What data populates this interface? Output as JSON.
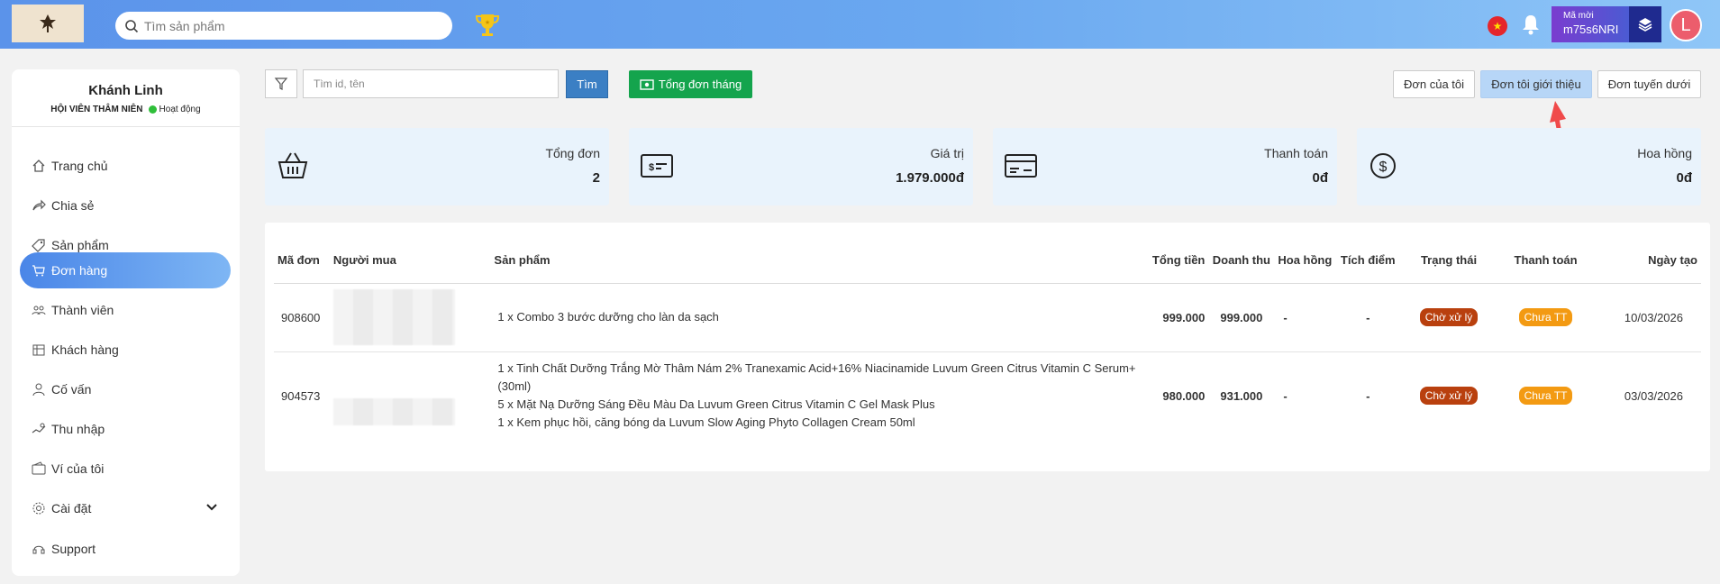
{
  "header": {
    "search_placeholder": "Tìm sản phẩm",
    "flag_icon": "vietnam-flag-icon",
    "code_label": "Mã mời",
    "code_value": "m75s6NRI",
    "avatar_letter": "L"
  },
  "profile": {
    "name": "Khánh Linh",
    "tier": "HỘI VIÊN THÂM NIÊN",
    "status": "Hoạt động"
  },
  "sidebar": {
    "items": [
      {
        "label": "Trang chủ",
        "icon": "home-icon"
      },
      {
        "label": "Chia sẻ",
        "icon": "share-icon"
      },
      {
        "label": "Sản phẩm",
        "icon": "tag-icon"
      },
      {
        "label": "Đơn hàng",
        "icon": "cart-icon",
        "active": true
      },
      {
        "label": "Thành viên",
        "icon": "members-icon"
      },
      {
        "label": "Khách hàng",
        "icon": "customers-icon"
      },
      {
        "label": "Cố vấn",
        "icon": "advisor-icon"
      },
      {
        "label": "Thu nhập",
        "icon": "income-icon"
      },
      {
        "label": "Ví của tôi",
        "icon": "wallet-icon"
      },
      {
        "label": "Cài đặt",
        "icon": "settings-icon"
      },
      {
        "label": "Support",
        "icon": "support-icon"
      }
    ]
  },
  "toolbar": {
    "filter_placeholder": "Tìm id, tên",
    "find_label": "Tìm",
    "month_label": "Tổng đơn tháng",
    "tabs": [
      "Đơn của tôi",
      "Đơn tôi giới thiệu",
      "Đơn tuyến dưới"
    ],
    "active_tab": 1
  },
  "stats": [
    {
      "label": "Tổng đơn",
      "value": "2",
      "icon": "basket-icon"
    },
    {
      "label": "Giá trị",
      "value": "1.979.000đ",
      "icon": "cash-icon"
    },
    {
      "label": "Thanh toán",
      "value": "0đ",
      "icon": "card-icon"
    },
    {
      "label": "Hoa hồng",
      "value": "0đ",
      "icon": "dollar-icon"
    }
  ],
  "table": {
    "headers": [
      "Mã đơn",
      "Người mua",
      "Sản phẩm",
      "Tổng tiền",
      "Doanh thu",
      "Hoa hồng",
      "Tích điểm",
      "Trạng thái",
      "Thanh toán",
      "Ngày tạo"
    ],
    "rows": [
      {
        "id": "908600",
        "products": [
          "1 x Combo 3 bước dưỡng cho làn da sạch"
        ],
        "total": "999.000",
        "revenue": "999.000",
        "commission": "-",
        "points": "-",
        "status": "Chờ xử lý",
        "payment": "Chưa TT",
        "date": "10/03/2026"
      },
      {
        "id": "904573",
        "products": [
          "1 x Tinh Chất Dưỡng Trắng Mờ Thâm Nám 2% Tranexamic Acid+16% Niacinamide Luvum Green Citrus Vitamin C Serum+(30ml)",
          "5 x Mặt Nạ Dưỡng Sáng Đều Màu Da Luvum Green Citrus Vitamin C Gel Mask Plus",
          "1 x Kem phục hồi, căng bóng da Luvum Slow Aging Phyto Collagen Cream 50ml"
        ],
        "total": "980.000",
        "revenue": "931.000",
        "commission": "-",
        "points": "-",
        "status": "Chờ xử lý",
        "payment": "Chưa TT",
        "date": "03/03/2026"
      }
    ]
  },
  "colors": {
    "accent": "#4a86e8",
    "success": "#14a44d",
    "status_processing": "#b9400e",
    "status_unpaid": "#f39a12"
  }
}
